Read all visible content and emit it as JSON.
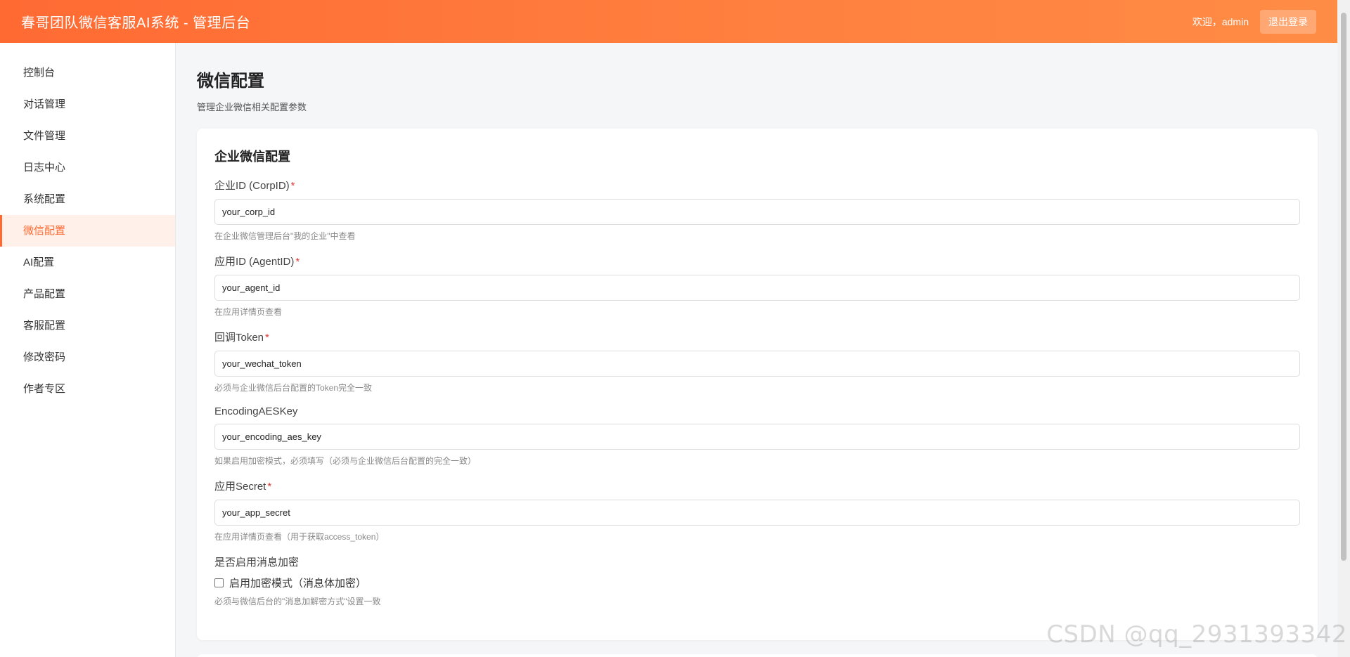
{
  "header": {
    "title": "春哥团队微信客服AI系统 - 管理后台",
    "welcome": "欢迎，admin",
    "logout_label": "退出登录"
  },
  "sidebar": {
    "items": [
      {
        "label": "控制台"
      },
      {
        "label": "对话管理"
      },
      {
        "label": "文件管理"
      },
      {
        "label": "日志中心"
      },
      {
        "label": "系统配置"
      },
      {
        "label": "微信配置",
        "active": true
      },
      {
        "label": "AI配置"
      },
      {
        "label": "产品配置"
      },
      {
        "label": "客服配置"
      },
      {
        "label": "修改密码"
      },
      {
        "label": "作者专区"
      }
    ]
  },
  "page": {
    "title": "微信配置",
    "subtitle": "管理企业微信相关配置参数"
  },
  "card": {
    "title": "企业微信配置",
    "fields": [
      {
        "label": "企业ID (CorpID)",
        "required": "*",
        "value": "your_corp_id",
        "help": "在企业微信管理后台\"我的企业\"中查看"
      },
      {
        "label": "应用ID (AgentID)",
        "required": "*",
        "value": "your_agent_id",
        "help": "在应用详情页查看"
      },
      {
        "label": "回调Token",
        "required": "*",
        "value": "your_wechat_token",
        "help": "必须与企业微信后台配置的Token完全一致"
      },
      {
        "label": "EncodingAESKey",
        "required": "",
        "value": "your_encoding_aes_key",
        "help": "如果启用加密模式，必须填写（必须与企业微信后台配置的完全一致）"
      },
      {
        "label": "应用Secret",
        "required": "*",
        "value": "your_app_secret",
        "help": "在应用详情页查看（用于获取access_token）"
      }
    ],
    "encryption": {
      "label": "是否启用消息加密",
      "checkbox_label": "启用加密模式（消息体加密）",
      "checked": false,
      "help": "必须与微信后台的\"消息加解密方式\"设置一致"
    }
  },
  "watermark": "CSDN @qq_2931393342",
  "colors": {
    "accent": "#ff6a33",
    "active_bg": "#fff1ea",
    "required": "#e53935"
  }
}
